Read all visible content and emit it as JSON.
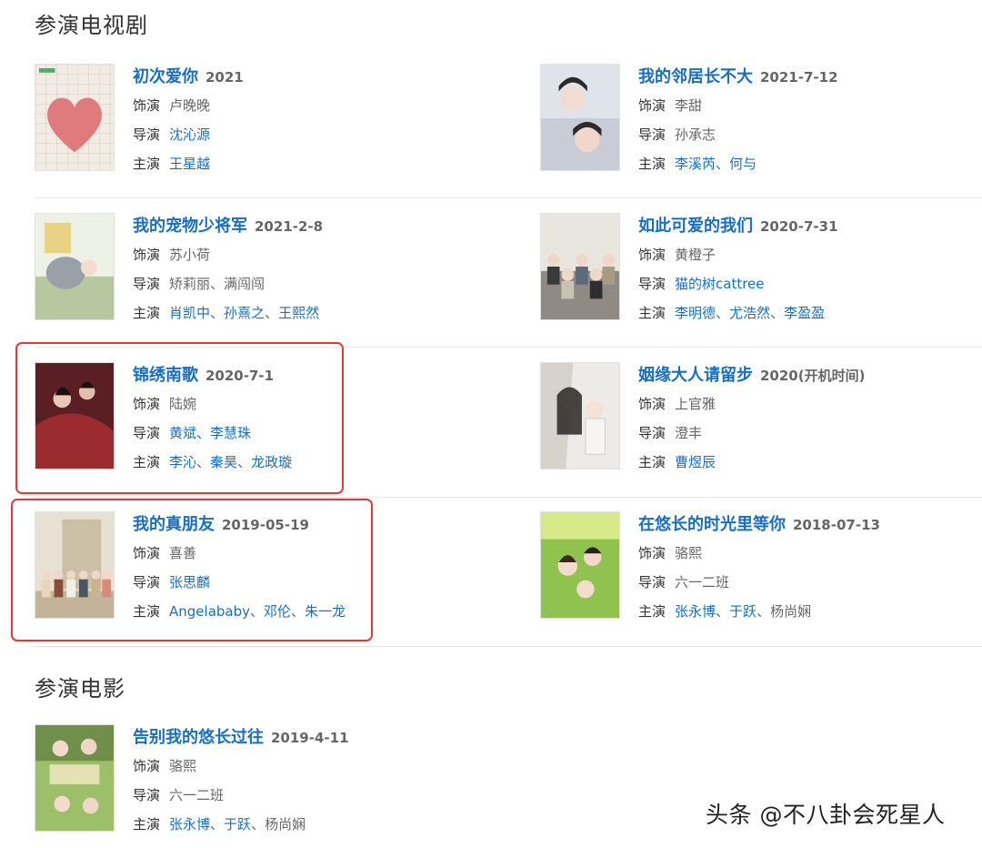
{
  "tv_section": {
    "title": "参演电视剧"
  },
  "movie_section": {
    "title": "参演电影"
  },
  "labels": {
    "role": "饰演",
    "director": "导演",
    "stars": "主演"
  },
  "tv": [
    {
      "title": "初次爱你",
      "date": "2021",
      "role": "卢晚晚",
      "director": {
        "text": "沈沁源",
        "linked": true
      },
      "stars": [
        {
          "name": "王星越",
          "linked": true
        }
      ]
    },
    {
      "title": "我的邻居长不大",
      "date": "2021-7-12",
      "role": "李甜",
      "director": {
        "text": "孙承志",
        "linked": false
      },
      "stars": [
        {
          "name": "李溪芮",
          "linked": true
        },
        {
          "name": "何与",
          "linked": true
        }
      ]
    },
    {
      "title": "我的宠物少将军",
      "date": "2021-2-8",
      "role": "苏小荷",
      "director": {
        "text": "矫莉丽、满闯闯",
        "linked": false
      },
      "stars": [
        {
          "name": "肖凯中",
          "linked": true
        },
        {
          "name": "孙熹之",
          "linked": true
        },
        {
          "name": "王熙然",
          "linked": true
        }
      ]
    },
    {
      "title": "如此可爱的我们",
      "date": "2020-7-31",
      "role": "黄橙子",
      "director": {
        "text": "猫的树cattree",
        "linked": true
      },
      "stars": [
        {
          "name": "李明德",
          "linked": true
        },
        {
          "name": "尤浩然",
          "linked": true
        },
        {
          "name": "李盈盈",
          "linked": true
        }
      ]
    },
    {
      "title": "锦绣南歌",
      "date": "2020-7-1",
      "role": "陆婉",
      "director": {
        "text": "黄斌、李慧珠",
        "linked": true
      },
      "stars": [
        {
          "name": "李沁",
          "linked": true
        },
        {
          "name": "秦昊",
          "linked": true
        },
        {
          "name": "龙政璇",
          "linked": true
        }
      ]
    },
    {
      "title": "姻缘大人请留步",
      "date": "2020(开机时间)",
      "role": "上官雅",
      "director": {
        "text": "澄丰",
        "linked": false
      },
      "stars": [
        {
          "name": "曹煜辰",
          "linked": true
        }
      ]
    },
    {
      "title": "我的真朋友",
      "date": "2019-05-19",
      "role": "喜善",
      "director": {
        "text": "张思麟",
        "linked": true
      },
      "stars": [
        {
          "name": "Angelababy",
          "linked": true
        },
        {
          "name": "邓伦",
          "linked": true
        },
        {
          "name": "朱一龙",
          "linked": true
        }
      ]
    },
    {
      "title": "在悠长的时光里等你",
      "date": "2018-07-13",
      "role": "骆熙",
      "director": {
        "text": "六一二班",
        "linked": false
      },
      "stars": [
        {
          "name": "张永博",
          "linked": true
        },
        {
          "name": "于跃",
          "linked": true
        },
        {
          "name": "杨尚娴",
          "linked": false
        }
      ]
    }
  ],
  "movies": [
    {
      "title": "告别我的悠长过往",
      "date": "2019-4-11",
      "role": "骆熙",
      "director": {
        "text": "六一二班",
        "linked": false
      },
      "stars": [
        {
          "name": "张永博",
          "linked": true
        },
        {
          "name": "于跃",
          "linked": true
        },
        {
          "name": "杨尚娴",
          "linked": false
        }
      ]
    }
  ],
  "watermark": "头条 @不八卦会死星人",
  "colors": {
    "link": "#1a6ebf",
    "highlight": "#e03a3a",
    "divider": "#e6e6e6"
  }
}
